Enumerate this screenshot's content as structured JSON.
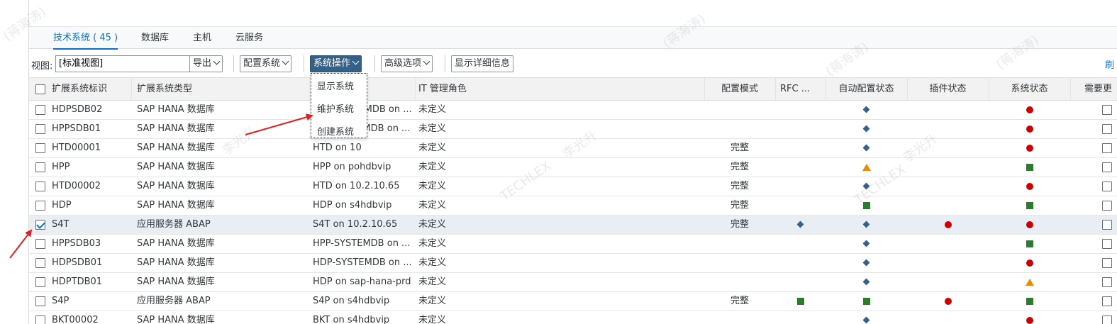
{
  "tabs": [
    {
      "label": "技术系统 ( 45 )",
      "active": true
    },
    {
      "label": "数据库",
      "active": false
    },
    {
      "label": "主机",
      "active": false
    },
    {
      "label": "云服务",
      "active": false
    }
  ],
  "toolbar": {
    "view_label": "视图:",
    "view_value": "[标准视图]",
    "export": "导出",
    "config_system": "配置系统",
    "system_ops": "系统操作",
    "advanced": "高级选项",
    "show_details": "显示详细信息",
    "right_link": "刷"
  },
  "menu": [
    "显示系统",
    "维护系统",
    "创建系统"
  ],
  "columns": {
    "id": "扩展系统标识",
    "type": "扩展系统类型",
    "it_role": "IT 管理角色",
    "config_mode": "配置模式",
    "rfc": "RFC ...",
    "auto_config": "自动配置状态",
    "plugin": "插件状态",
    "system_status": "系统状态",
    "need_update": "需要更"
  },
  "rows": [
    {
      "id": "HDPSDB02",
      "type": "SAP HANA 数据库",
      "name": "HDP-SYSTEMDB on ...",
      "role": "未定义",
      "mode": "",
      "rfc": "",
      "auto": "diamond",
      "plugin": "",
      "status": "circle",
      "checked": false
    },
    {
      "id": "HPPSDB01",
      "type": "SAP HANA 数据库",
      "name": "HPP-SYSTEMDB on ...",
      "role": "未定义",
      "mode": "",
      "rfc": "",
      "auto": "diamond",
      "plugin": "",
      "status": "circle",
      "checked": false
    },
    {
      "id": "HTD00001",
      "type": "SAP HANA 数据库",
      "name": "HTD on 10",
      "role": "未定义",
      "mode": "完整",
      "rfc": "",
      "auto": "diamond",
      "plugin": "",
      "status": "circle",
      "checked": false
    },
    {
      "id": "HPP",
      "type": "SAP HANA 数据库",
      "name": "HPP on pohdbvip",
      "role": "未定义",
      "mode": "完整",
      "rfc": "",
      "auto": "triangle",
      "plugin": "",
      "status": "square",
      "checked": false
    },
    {
      "id": "HTD00002",
      "type": "SAP HANA 数据库",
      "name": "HTD on 10.2.10.65",
      "role": "未定义",
      "mode": "完整",
      "rfc": "",
      "auto": "diamond",
      "plugin": "",
      "status": "circle",
      "checked": false
    },
    {
      "id": "HDP",
      "type": "SAP HANA 数据库",
      "name": "HDP on s4hdbvip",
      "role": "未定义",
      "mode": "完整",
      "rfc": "",
      "auto": "square",
      "plugin": "",
      "status": "square",
      "checked": false
    },
    {
      "id": "S4T",
      "type": "应用服务器 ABAP",
      "name": "S4T on 10.2.10.65",
      "role": "未定义",
      "mode": "完整",
      "rfc": "diamond",
      "auto": "diamond",
      "plugin": "circle",
      "status": "circle",
      "checked": true
    },
    {
      "id": "HPPSDB03",
      "type": "SAP HANA 数据库",
      "name": "HPP-SYSTEMDB on ...",
      "role": "未定义",
      "mode": "",
      "rfc": "",
      "auto": "diamond",
      "plugin": "",
      "status": "square",
      "checked": false
    },
    {
      "id": "HDPSDB01",
      "type": "SAP HANA 数据库",
      "name": "HDP-SYSTEMDB on ...",
      "role": "未定义",
      "mode": "",
      "rfc": "",
      "auto": "diamond",
      "plugin": "",
      "status": "circle",
      "checked": false
    },
    {
      "id": "HDPTDB01",
      "type": "SAP HANA 数据库",
      "name": "HDP on sap-hana-prd",
      "role": "未定义",
      "mode": "",
      "rfc": "",
      "auto": "diamond",
      "plugin": "",
      "status": "triangle",
      "checked": false
    },
    {
      "id": "S4P",
      "type": "应用服务器 ABAP",
      "name": "S4P on s4hdbvip",
      "role": "未定义",
      "mode": "完整",
      "rfc": "square",
      "auto": "square",
      "plugin": "circle",
      "status": "square",
      "checked": false
    },
    {
      "id": "BKT00002",
      "type": "SAP HANA 数据库",
      "name": "BKT on s4hdbvip",
      "role": "未定义",
      "mode": "",
      "rfc": "",
      "auto": "diamond",
      "plugin": "",
      "status": "circle",
      "checked": false
    }
  ],
  "watermarks": [
    "(蒋海涛)",
    "(蒋海涛)",
    "(蒋海涛)",
    "(蒋海涛)",
    "李光升",
    "李光升",
    "TECHLEX",
    "李光升",
    "TECHLEX"
  ],
  "colors": {
    "accent": "#0a6ed1",
    "primary_button": "#346187",
    "error": "#cc0000",
    "success": "#2b7d2b",
    "warning": "#e78c07",
    "arrow": "#e02020"
  }
}
